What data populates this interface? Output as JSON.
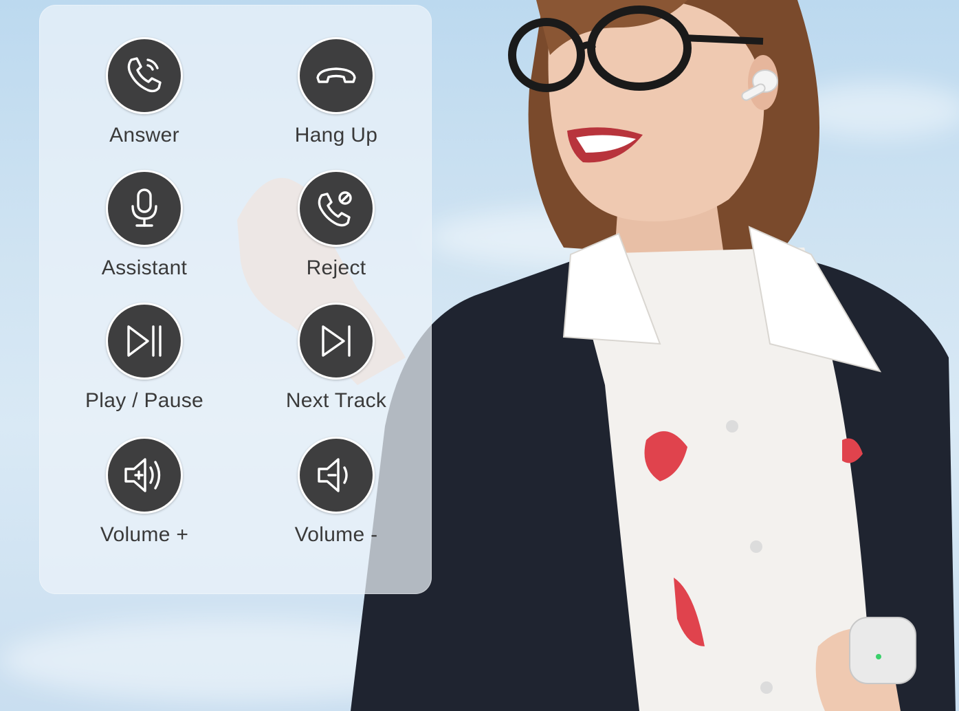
{
  "controls": [
    {
      "label": "Answer",
      "icon": "phone-answer-icon"
    },
    {
      "label": "Hang Up",
      "icon": "phone-hangup-icon"
    },
    {
      "label": "Assistant",
      "icon": "microphone-icon"
    },
    {
      "label": "Reject",
      "icon": "phone-reject-icon"
    },
    {
      "label": "Play / Pause",
      "icon": "play-pause-icon"
    },
    {
      "label": "Next Track",
      "icon": "next-track-icon"
    },
    {
      "label": "Volume +",
      "icon": "volume-up-icon"
    },
    {
      "label": "Volume -",
      "icon": "volume-down-icon"
    }
  ],
  "colors": {
    "icon_circle": "#3e3e3f",
    "icon_stroke": "#ffffff",
    "label_text": "#3a3a3a",
    "panel_tint": "#ecf3f9",
    "sky": "#c9def0",
    "blazer": "#1f2430",
    "shirt": "#f3f1ee",
    "hair": "#7a4a2c",
    "lips": "#b8343c"
  }
}
